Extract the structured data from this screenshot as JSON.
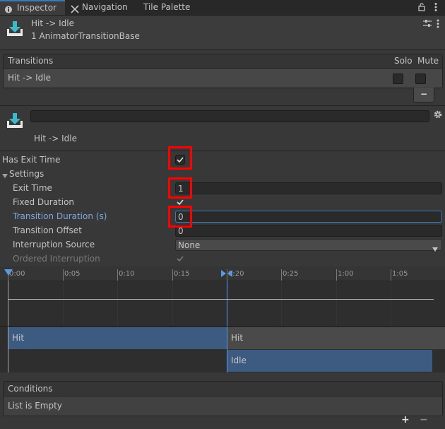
{
  "tabs": {
    "inspector": "Inspector",
    "navigation": "Navigation",
    "tile_palette": "Tile Palette"
  },
  "header": {
    "title": "Hit -> Idle",
    "subtitle": "1 AnimatorTransitionBase"
  },
  "transitions": {
    "header": "Transitions",
    "solo": "Solo",
    "mute": "Mute",
    "rows": [
      {
        "label": "Hit -> Idle"
      }
    ],
    "remove_label": "−"
  },
  "transition": {
    "name": "",
    "title": "Hit -> Idle"
  },
  "fields": {
    "has_exit_time": {
      "label": "Has Exit Time",
      "checked": true
    },
    "settings": "Settings",
    "exit_time": {
      "label": "Exit Time",
      "value": "1"
    },
    "fixed_duration": {
      "label": "Fixed Duration",
      "checked": true
    },
    "transition_duration": {
      "label": "Transition Duration (s)",
      "value": "0"
    },
    "transition_offset": {
      "label": "Transition Offset",
      "value": "0"
    },
    "interruption_source": {
      "label": "Interruption Source",
      "value": "None"
    },
    "ordered_interruption": {
      "label": "Ordered Interruption",
      "checked": true
    }
  },
  "timeline": {
    "ticks": [
      "0:00",
      "0:05",
      "0:10",
      "0:15",
      "0:20",
      "0:25",
      "1:00",
      "1:05"
    ],
    "source_state": "Hit",
    "source_state_repeat": "Hit",
    "destination_state": "Idle"
  },
  "conditions": {
    "header": "Conditions",
    "empty_text": "List is Empty",
    "add_label": "+",
    "remove_label": "−"
  },
  "colors": {
    "accent": "#3a79bb",
    "highlight": "#ff0000",
    "track_blue": "#3d5a80"
  }
}
